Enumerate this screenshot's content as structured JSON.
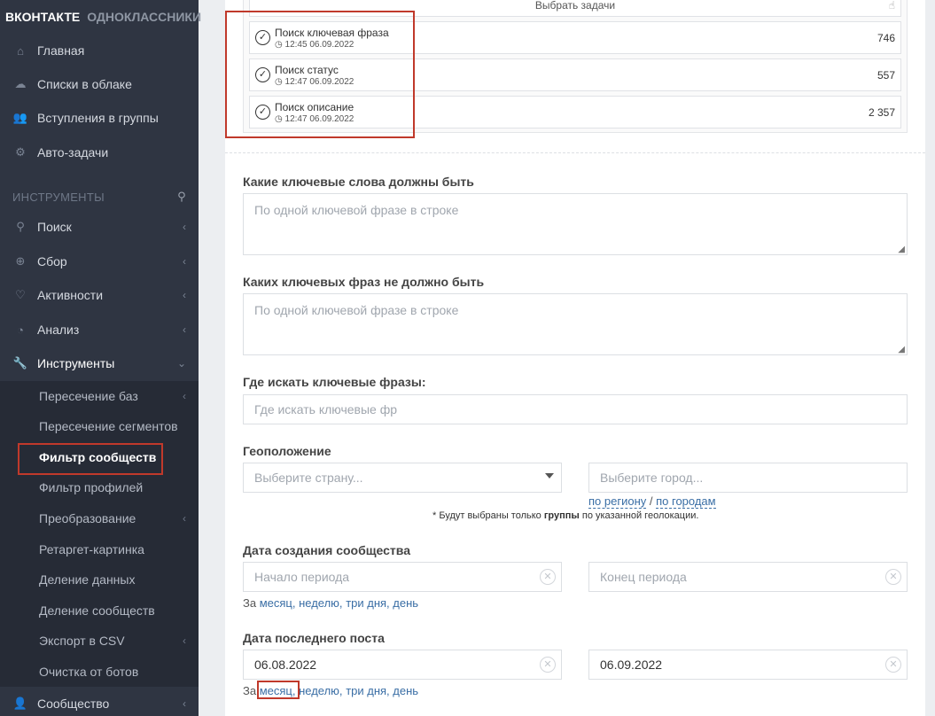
{
  "brand": {
    "active": "ВКОНТАКТЕ",
    "inactive": "ОДНОКЛАССНИКИ"
  },
  "sidebar": {
    "main_items": [
      {
        "label": "Главная",
        "icon": "home-icon"
      },
      {
        "label": "Списки в облаке",
        "icon": "cloud-icon"
      },
      {
        "label": "Вступления в группы",
        "icon": "users-icon"
      },
      {
        "label": "Авто-задачи",
        "icon": "gears-icon"
      }
    ],
    "tools_title": "ИНСТРУМЕНТЫ",
    "tool_items": [
      {
        "label": "Поиск",
        "icon": "search-icon"
      },
      {
        "label": "Сбор",
        "icon": "zoom-plus-icon"
      },
      {
        "label": "Активности",
        "icon": "heart-icon"
      },
      {
        "label": "Анализ",
        "icon": "chart-icon"
      },
      {
        "label": "Инструменты",
        "icon": "wrench-icon"
      }
    ],
    "sub_items": [
      {
        "label": "Пересечение баз",
        "chevron": true
      },
      {
        "label": "Пересечение сегментов",
        "chevron": false
      },
      {
        "label": "Фильтр сообществ",
        "chevron": false
      },
      {
        "label": "Фильтр профилей",
        "chevron": false
      },
      {
        "label": "Преобразование",
        "chevron": true
      },
      {
        "label": "Ретаргет-картинка",
        "chevron": false
      },
      {
        "label": "Деление данных",
        "chevron": false
      },
      {
        "label": "Деление сообществ",
        "chevron": false
      },
      {
        "label": "Экспорт в CSV",
        "chevron": true
      },
      {
        "label": "Очистка от ботов",
        "chevron": false
      }
    ],
    "bottom_item": {
      "label": "Сообщество",
      "icon": "user-icon"
    }
  },
  "tasks": {
    "header": "Выбрать задачи",
    "rows": [
      {
        "title": "Поиск ключевая фраза",
        "time": "12:45 06.09.2022",
        "count": "746"
      },
      {
        "title": "Поиск статус",
        "time": "12:47 06.09.2022",
        "count": "557"
      },
      {
        "title": "Поиск описание",
        "time": "12:47 06.09.2022",
        "count": "2 357"
      }
    ]
  },
  "form": {
    "include_label": "Какие ключевые слова должны быть",
    "include_placeholder": "По одной ключевой фразе в строке",
    "exclude_label": "Каких ключевых фраз не должно быть",
    "exclude_placeholder": "По одной ключевой фразе в строке",
    "where_label": "Где искать ключевые фразы:",
    "where_placeholder": "Где искать ключевые фр",
    "geo_label": "Геоположение",
    "country_placeholder": "Выберите страну...",
    "city_placeholder": "Выберите город...",
    "by_region": "по региону",
    "slash": " / ",
    "by_cities": "по городам",
    "geo_note_prefix": "* Будут выбраны только ",
    "geo_note_bold": "группы",
    "geo_note_suffix": " по указанной геолокации.",
    "created_label": "Дата создания сообщества",
    "created_start_placeholder": "Начало периода",
    "created_end_placeholder": "Конец периода",
    "period_prefix": "За ",
    "period_month": "месяц,",
    "period_week": "неделю,",
    "period_three_days": "три дня,",
    "period_day": "день",
    "lastpost_label": "Дата последнего поста",
    "lastpost_start": "06.08.2022",
    "lastpost_end": "06.09.2022"
  }
}
